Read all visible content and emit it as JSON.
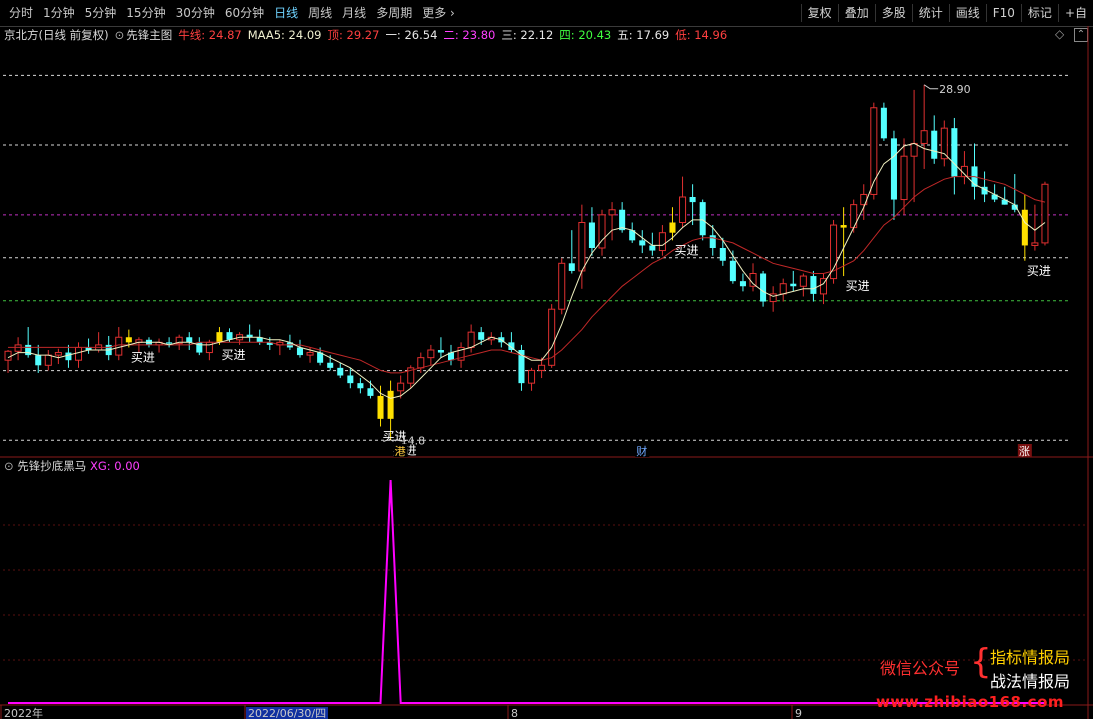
{
  "toolbar": {
    "periods": [
      "分时",
      "1分钟",
      "5分钟",
      "15分钟",
      "30分钟",
      "60分钟",
      "日线",
      "周线",
      "月线",
      "多周期",
      "更多"
    ],
    "active_index": 6,
    "right_buttons": [
      "复权",
      "叠加",
      "多股",
      "统计",
      "画线",
      "F10",
      "标记",
      "+自"
    ]
  },
  "main_info": {
    "stock": "京北方(日线 前复权)",
    "indicator": "先锋主图",
    "niuxian": "牛线: 24.87",
    "maa5": "MAA5: 24.09",
    "ding": "顶: 29.27",
    "yi": "一: 26.54",
    "er": "二: 23.80",
    "san": "三: 22.12",
    "si": "四: 20.43",
    "wu": "五: 17.69",
    "di": "低: 14.96"
  },
  "sub_info": {
    "indicator": "先锋抄底黑马",
    "xg": "XG: 0.00"
  },
  "annotations": {
    "high_label": "28.90",
    "buy_label": "买进",
    "low_label": "14.8",
    "markers": [
      "港",
      "财",
      "涨"
    ]
  },
  "time_axis": {
    "labels": [
      "2022年",
      "2022/06/30/四",
      "8",
      "9"
    ]
  },
  "watermark": {
    "left": "微信公众号",
    "right_top": "指标情报局",
    "right_bottom": "战法情报局",
    "url": "www.zhibiao168.com"
  },
  "colors": {
    "up": "#e03030",
    "down": "#54ffff",
    "signal": "#ffe000",
    "ma_white": "#f0f0c0",
    "ma_red": "#c02828",
    "xg": "#ff00ff"
  },
  "chart_data": {
    "type": "candlestick",
    "y_price_range": [
      14.5,
      30.5
    ],
    "levels": [
      {
        "name": "顶",
        "value": 29.27
      },
      {
        "name": "一",
        "value": 26.54
      },
      {
        "name": "二",
        "value": 23.8
      },
      {
        "name": "三",
        "value": 22.12
      },
      {
        "name": "四",
        "value": 20.43
      },
      {
        "name": "五",
        "value": 17.69
      },
      {
        "name": "低",
        "value": 14.96
      }
    ],
    "candles": [
      [
        18.1,
        18.5,
        17.6,
        18.45
      ],
      [
        18.45,
        19.0,
        18.1,
        18.7
      ],
      [
        18.7,
        19.4,
        18.2,
        18.3
      ],
      [
        18.3,
        18.7,
        17.6,
        17.9
      ],
      [
        17.9,
        18.5,
        17.7,
        18.3
      ],
      [
        18.3,
        18.55,
        17.95,
        18.4
      ],
      [
        18.4,
        18.7,
        17.8,
        18.1
      ],
      [
        18.1,
        18.8,
        17.8,
        18.6
      ],
      [
        18.6,
        18.95,
        18.35,
        18.5
      ],
      [
        18.5,
        19.2,
        18.4,
        18.7
      ],
      [
        18.7,
        19.05,
        18.1,
        18.3
      ],
      [
        18.3,
        19.4,
        18.1,
        19.0
      ],
      [
        19.0,
        19.3,
        18.6,
        18.8
      ],
      [
        18.8,
        19.0,
        18.4,
        18.9
      ],
      [
        18.9,
        19.0,
        18.6,
        18.7
      ],
      [
        18.7,
        18.95,
        18.4,
        18.8
      ],
      [
        18.8,
        19.0,
        18.6,
        18.75
      ],
      [
        18.75,
        19.1,
        18.5,
        19.0
      ],
      [
        19.0,
        19.2,
        18.5,
        18.8
      ],
      [
        18.8,
        19.0,
        18.3,
        18.4
      ],
      [
        18.4,
        18.9,
        18.1,
        18.8
      ],
      [
        18.8,
        19.4,
        18.7,
        19.2
      ],
      [
        19.2,
        19.35,
        18.8,
        18.9
      ],
      [
        18.9,
        19.2,
        18.7,
        19.1
      ],
      [
        19.1,
        19.5,
        18.8,
        19.0
      ],
      [
        19.0,
        19.3,
        18.7,
        18.8
      ],
      [
        18.8,
        19.0,
        18.5,
        18.7
      ],
      [
        18.7,
        18.9,
        18.3,
        18.8
      ],
      [
        18.8,
        19.1,
        18.5,
        18.6
      ],
      [
        18.6,
        18.9,
        18.2,
        18.3
      ],
      [
        18.3,
        18.6,
        18.0,
        18.4
      ],
      [
        18.4,
        18.6,
        17.9,
        18.0
      ],
      [
        18.0,
        18.3,
        17.7,
        17.8
      ],
      [
        17.8,
        18.0,
        17.4,
        17.5
      ],
      [
        17.5,
        17.8,
        17.0,
        17.2
      ],
      [
        17.2,
        17.4,
        16.8,
        17.0
      ],
      [
        17.0,
        17.3,
        16.6,
        16.7
      ],
      [
        16.7,
        17.1,
        15.5,
        15.8
      ],
      [
        15.8,
        17.3,
        14.96,
        16.9
      ],
      [
        16.9,
        17.5,
        16.6,
        17.2
      ],
      [
        17.2,
        17.9,
        17.0,
        17.8
      ],
      [
        17.8,
        18.4,
        17.6,
        18.2
      ],
      [
        18.2,
        18.7,
        17.9,
        18.5
      ],
      [
        18.5,
        19.0,
        18.2,
        18.4
      ],
      [
        18.4,
        18.7,
        17.9,
        18.1
      ],
      [
        18.1,
        18.8,
        17.8,
        18.6
      ],
      [
        18.6,
        19.5,
        18.4,
        19.2
      ],
      [
        19.2,
        19.4,
        18.7,
        18.9
      ],
      [
        18.9,
        19.2,
        18.7,
        19.0
      ],
      [
        19.0,
        19.2,
        18.6,
        18.8
      ],
      [
        18.8,
        19.2,
        18.4,
        18.5
      ],
      [
        18.5,
        18.7,
        16.9,
        17.2
      ],
      [
        17.2,
        17.8,
        16.9,
        17.7
      ],
      [
        17.7,
        18.2,
        17.4,
        17.9
      ],
      [
        17.9,
        20.3,
        17.8,
        20.1
      ],
      [
        20.1,
        22.1,
        19.9,
        21.9
      ],
      [
        21.9,
        23.2,
        21.5,
        21.6
      ],
      [
        21.6,
        24.2,
        20.9,
        23.5
      ],
      [
        23.5,
        24.1,
        22.2,
        22.5
      ],
      [
        22.5,
        24.0,
        22.2,
        23.8
      ],
      [
        23.8,
        24.3,
        22.8,
        24.0
      ],
      [
        24.0,
        24.3,
        23.1,
        23.2
      ],
      [
        23.2,
        23.5,
        22.7,
        22.8
      ],
      [
        22.8,
        23.2,
        22.3,
        22.6
      ],
      [
        22.6,
        23.1,
        22.2,
        22.4
      ],
      [
        22.4,
        23.4,
        22.2,
        23.1
      ],
      [
        23.1,
        24.1,
        22.8,
        23.5
      ],
      [
        23.5,
        25.3,
        23.3,
        24.5
      ],
      [
        24.5,
        25.0,
        23.4,
        24.3
      ],
      [
        24.3,
        24.4,
        22.8,
        23.0
      ],
      [
        23.0,
        23.4,
        22.2,
        22.5
      ],
      [
        22.5,
        22.9,
        21.8,
        22.0
      ],
      [
        22.0,
        22.4,
        21.1,
        21.2
      ],
      [
        21.2,
        21.5,
        20.8,
        21.0
      ],
      [
        21.0,
        21.9,
        20.8,
        21.5
      ],
      [
        21.5,
        21.6,
        20.2,
        20.4
      ],
      [
        20.4,
        21.0,
        20.0,
        20.7
      ],
      [
        20.7,
        21.3,
        20.4,
        21.1
      ],
      [
        21.1,
        21.6,
        20.8,
        21.0
      ],
      [
        21.0,
        21.5,
        20.6,
        21.4
      ],
      [
        21.4,
        21.6,
        20.4,
        20.7
      ],
      [
        20.7,
        21.5,
        20.3,
        21.3
      ],
      [
        21.3,
        23.6,
        21.1,
        23.4
      ],
      [
        23.4,
        24.1,
        21.4,
        23.3
      ],
      [
        23.3,
        24.4,
        23.1,
        24.2
      ],
      [
        24.2,
        25.0,
        23.6,
        24.6
      ],
      [
        24.6,
        28.2,
        24.4,
        28.0
      ],
      [
        28.0,
        28.2,
        26.7,
        26.8
      ],
      [
        26.8,
        27.1,
        23.6,
        24.4
      ],
      [
        24.4,
        26.8,
        23.8,
        26.1
      ],
      [
        26.1,
        28.7,
        24.3,
        26.6
      ],
      [
        26.6,
        28.9,
        25.6,
        27.1
      ],
      [
        27.1,
        27.7,
        25.8,
        26.0
      ],
      [
        26.0,
        27.5,
        25.7,
        27.2
      ],
      [
        27.2,
        27.6,
        24.6,
        25.3
      ],
      [
        25.3,
        26.3,
        25.0,
        25.7
      ],
      [
        25.7,
        26.6,
        24.4,
        24.9
      ],
      [
        24.9,
        25.5,
        24.3,
        24.6
      ],
      [
        24.6,
        25.0,
        24.3,
        24.4
      ],
      [
        24.4,
        24.9,
        24.2,
        24.2
      ],
      [
        24.2,
        25.4,
        23.9,
        24.0
      ],
      [
        24.0,
        24.6,
        22.0,
        22.6
      ],
      [
        22.6,
        24.2,
        22.4,
        22.7
      ],
      [
        22.7,
        25.1,
        22.6,
        25.0
      ]
    ],
    "ma_white": [
      18.2,
      18.4,
      18.4,
      18.3,
      18.3,
      18.2,
      18.3,
      18.4,
      18.5,
      18.5,
      18.5,
      18.6,
      18.7,
      18.8,
      18.8,
      18.8,
      18.7,
      18.8,
      18.8,
      18.7,
      18.7,
      18.8,
      18.9,
      19.0,
      19.0,
      19.0,
      18.9,
      18.9,
      18.8,
      18.6,
      18.5,
      18.4,
      18.2,
      18.0,
      17.8,
      17.5,
      17.2,
      16.8,
      16.6,
      16.7,
      17.0,
      17.4,
      17.8,
      18.2,
      18.4,
      18.5,
      18.6,
      18.8,
      19.0,
      18.9,
      18.6,
      18.3,
      18.1,
      18.1,
      18.6,
      19.5,
      20.6,
      21.6,
      22.3,
      22.8,
      23.2,
      23.3,
      23.2,
      22.9,
      22.6,
      22.6,
      22.9,
      23.3,
      23.6,
      23.6,
      23.3,
      22.8,
      22.2,
      21.6,
      21.1,
      20.8,
      20.6,
      20.7,
      20.8,
      20.9,
      20.9,
      21.1,
      21.7,
      22.5,
      23.3,
      24.1,
      25.1,
      25.8,
      26.1,
      26.5,
      26.6,
      26.4,
      26.3,
      26.2,
      25.8,
      25.4,
      25.0,
      24.8,
      24.6,
      24.4,
      24.2,
      23.5,
      23.2,
      23.5
    ],
    "ma_red": [
      18.6,
      18.6,
      18.6,
      18.6,
      18.6,
      18.6,
      18.6,
      18.6,
      18.6,
      18.6,
      18.6,
      18.7,
      18.7,
      18.7,
      18.7,
      18.7,
      18.7,
      18.7,
      18.7,
      18.8,
      18.8,
      18.8,
      18.8,
      18.8,
      18.8,
      18.8,
      18.8,
      18.7,
      18.7,
      18.7,
      18.6,
      18.5,
      18.4,
      18.3,
      18.2,
      18.1,
      17.9,
      17.7,
      17.6,
      17.6,
      17.7,
      17.8,
      17.9,
      18.0,
      18.1,
      18.2,
      18.3,
      18.4,
      18.5,
      18.5,
      18.4,
      18.3,
      18.2,
      18.1,
      18.2,
      18.5,
      18.9,
      19.3,
      19.8,
      20.2,
      20.6,
      21.0,
      21.3,
      21.6,
      21.9,
      22.1,
      22.4,
      22.6,
      22.8,
      22.9,
      22.9,
      22.8,
      22.7,
      22.5,
      22.3,
      22.1,
      21.9,
      21.8,
      21.7,
      21.6,
      21.5,
      21.5,
      21.6,
      21.8,
      22.0,
      22.4,
      22.9,
      23.4,
      23.7,
      24.1,
      24.5,
      24.8,
      25.0,
      25.2,
      25.3,
      25.3,
      25.3,
      25.2,
      25.1,
      25.0,
      24.8,
      24.6,
      24.4,
      24.3
    ],
    "signals": [
      12,
      21,
      37,
      38,
      66,
      83,
      101
    ],
    "xg_peak_index": 38,
    "xg_values": [
      0,
      0,
      0,
      0,
      0,
      0,
      0,
      0,
      0,
      0,
      0,
      0,
      0,
      0,
      0,
      0,
      0,
      0,
      0,
      0,
      0,
      0,
      0,
      0,
      0,
      0,
      0,
      0,
      0,
      0,
      0,
      0,
      0,
      0,
      0,
      0,
      0,
      0,
      1,
      0,
      0,
      0,
      0,
      0,
      0,
      0,
      0,
      0,
      0,
      0,
      0,
      0,
      0,
      0,
      0,
      0,
      0,
      0,
      0,
      0,
      0,
      0,
      0,
      0,
      0,
      0,
      0,
      0,
      0,
      0,
      0,
      0,
      0,
      0,
      0,
      0,
      0,
      0,
      0,
      0,
      0,
      0,
      0,
      0,
      0,
      0,
      0,
      0,
      0,
      0,
      0,
      0,
      0,
      0,
      0,
      0,
      0,
      0,
      0,
      0,
      0,
      0,
      0,
      0
    ]
  }
}
